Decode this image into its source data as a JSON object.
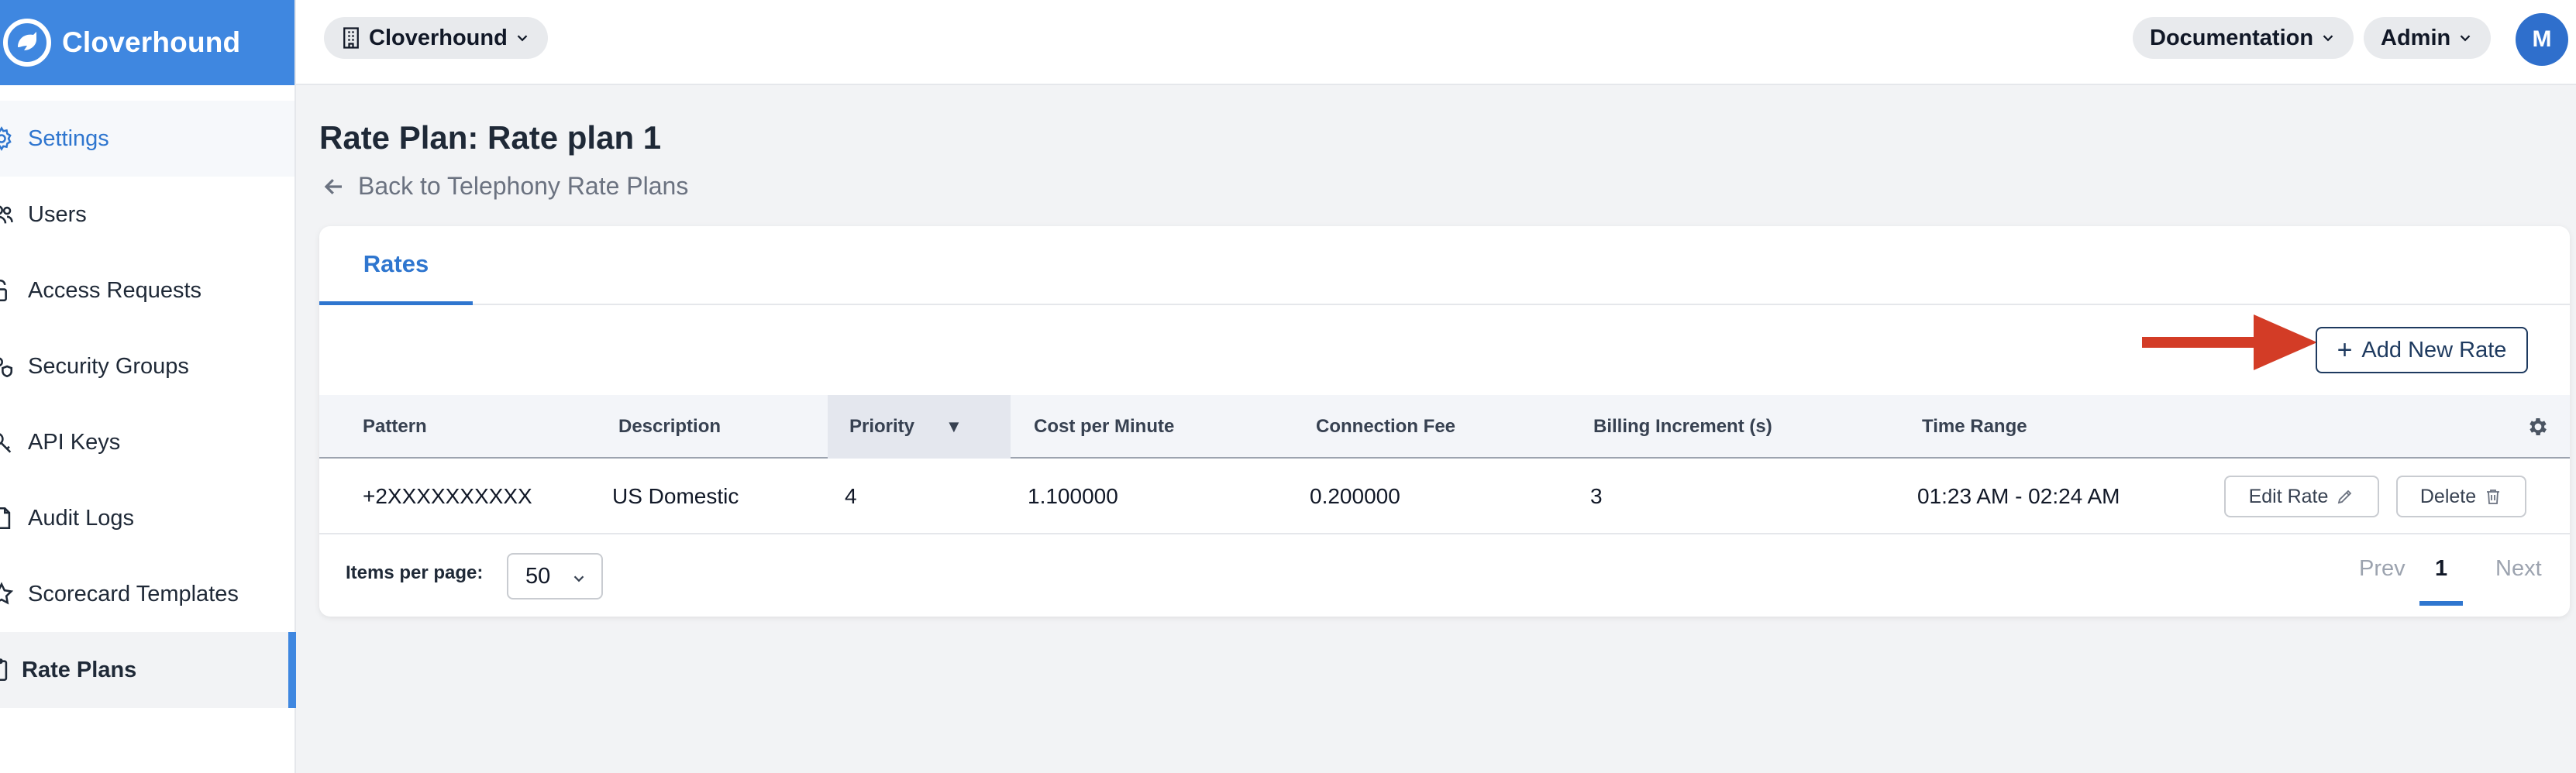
{
  "brand": {
    "name": "Cloverhound"
  },
  "sidebar": {
    "items": [
      {
        "label": "Settings",
        "icon": "gear-icon"
      },
      {
        "label": "Users",
        "icon": "users-icon"
      },
      {
        "label": "Access Requests",
        "icon": "unlock-icon"
      },
      {
        "label": "Security Groups",
        "icon": "security-groups-icon"
      },
      {
        "label": "API Keys",
        "icon": "key-icon"
      },
      {
        "label": "Audit Logs",
        "icon": "document-icon"
      },
      {
        "label": "Scorecard Templates",
        "icon": "star-icon"
      },
      {
        "label": "Rate Plans",
        "icon": "clipboard-icon"
      }
    ]
  },
  "topbar": {
    "org_label": "Cloverhound",
    "documentation_label": "Documentation",
    "admin_label": "Admin",
    "avatar_initial": "M"
  },
  "page": {
    "title": "Rate Plan: Rate plan 1",
    "back_label": "Back to Telephony Rate Plans"
  },
  "tabs": [
    {
      "label": "Rates"
    }
  ],
  "toolbar": {
    "add_label": "Add New Rate",
    "accent": "#d33c26"
  },
  "table": {
    "columns": [
      "Pattern",
      "Description",
      "Priority",
      "Cost per Minute",
      "Connection Fee",
      "Billing Increment (s)",
      "Time Range"
    ],
    "sort_indicator": "▼",
    "rows": [
      {
        "pattern": "+2XXXXXXXXXX",
        "description": "US Domestic",
        "priority": "4",
        "cost_per_minute": "1.100000",
        "connection_fee": "0.200000",
        "billing_increment": "3",
        "time_range": "01:23 AM - 02:24 AM",
        "edit_label": "Edit Rate",
        "delete_label": "Delete"
      }
    ]
  },
  "pagination": {
    "items_per_page_label": "Items per page:",
    "items_per_page_value": "50",
    "prev_label": "Prev",
    "current_page": "1",
    "next_label": "Next"
  }
}
